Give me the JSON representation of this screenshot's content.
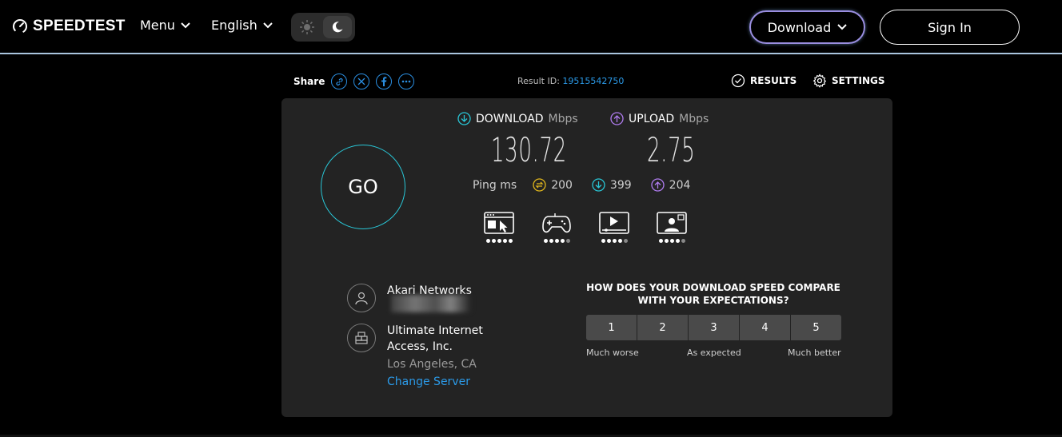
{
  "header": {
    "logo_text": "SPEEDTEST",
    "menu_label": "Menu",
    "language_label": "English",
    "download_label": "Download",
    "signin_label": "Sign In"
  },
  "share_bar": {
    "share_label": "Share",
    "result_id_label": "Result ID:",
    "result_id": "19515542750",
    "results_label": "RESULTS",
    "settings_label": "SETTINGS"
  },
  "metrics": {
    "download_label": "DOWNLOAD",
    "download_unit": "Mbps",
    "download_value": "130.72",
    "upload_label": "UPLOAD",
    "upload_unit": "Mbps",
    "upload_value": "2.75",
    "ping_label": "Ping",
    "ping_unit": "ms",
    "ping_idle": "200",
    "ping_download": "399",
    "ping_upload": "204"
  },
  "go_label": "GO",
  "usage_ratings": [
    {
      "icon": "web-browsing-icon",
      "rating": 5
    },
    {
      "icon": "gaming-icon",
      "rating": 4
    },
    {
      "icon": "video-streaming-icon",
      "rating": 4
    },
    {
      "icon": "video-call-icon",
      "rating": 4
    }
  ],
  "connection": {
    "isp_name": "Akari Networks",
    "server_name_line1": "Ultimate Internet",
    "server_name_line2": "Access, Inc.",
    "server_location": "Los Angeles, CA",
    "change_server_label": "Change Server"
  },
  "survey": {
    "question_line1": "HOW DOES YOUR DOWNLOAD SPEED COMPARE",
    "question_line2": "WITH YOUR EXPECTATIONS?",
    "options": [
      "1",
      "2",
      "3",
      "4",
      "5"
    ],
    "label_low": "Much worse",
    "label_mid": "As expected",
    "label_high": "Much better"
  },
  "colors": {
    "download_accent": "#29c6d6",
    "upload_accent": "#b07cf0",
    "ping_accent": "#e2b81c",
    "link": "#2b9ae8"
  }
}
